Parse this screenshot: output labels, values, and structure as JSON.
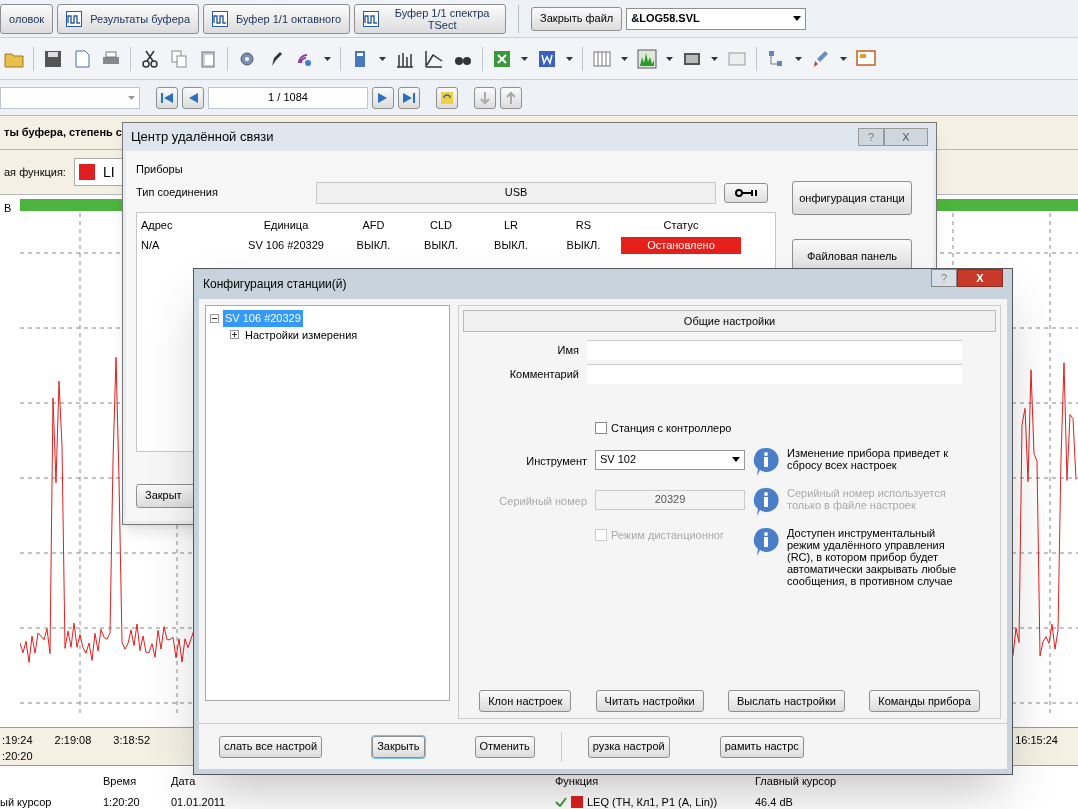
{
  "tabs": [
    {
      "label": "оловок",
      "icon": false
    },
    {
      "label": "Результаты буфера",
      "icon": true
    },
    {
      "label": "Буфер 1/1 октавного",
      "icon": true
    },
    {
      "label": "Буфер 1/1 спектра TSect",
      "icon": true
    }
  ],
  "close_file_button": "Закрыть файл",
  "file_select": "&LOG58.SVL",
  "navigator": {
    "position": "1 / 1084"
  },
  "buffer_title": "ты буфера, степень с",
  "function_row": {
    "label": "ая функция:",
    "value": "LI",
    "color": "#e02020"
  },
  "axis_unit": "B",
  "time_axis": {
    "left": [
      ":19:24",
      "2:19:08",
      "3:18:52"
    ],
    "left_second": ":20:20",
    "right": "16:15:24"
  },
  "bottom_panel": {
    "left_headers": [
      "Время",
      "Дата"
    ],
    "left_row": [
      "ый курсор",
      "1:20:20",
      "01.01.2011"
    ],
    "right_headers": [
      "Функция",
      "Главный курсор"
    ],
    "right_row": {
      "checked": true,
      "color": "#e02020",
      "function": "LEQ (TH, Кл1, P1 (A, Lin))",
      "value": "46.4 dB"
    }
  },
  "remote_dialog": {
    "title": "Центр удалённой связи",
    "devices_label": "Приборы",
    "connection_label": "Тип соединения",
    "connection_value": "USB",
    "columns": [
      "Адрес",
      "Единица",
      "AFD",
      "CLD",
      "LR",
      "RS",
      "Статус"
    ],
    "title_buttons": [
      "?",
      "X"
    ],
    "rows": [
      {
        "cells": [
          "N/A",
          "SV 106 #20329",
          "ВЫКЛ.",
          "ВЫКЛ.",
          "ВЫКЛ.",
          "ВЫКЛ.",
          "Остановлено"
        ]
      }
    ],
    "side_buttons": [
      "онфигурация станци",
      "Файловая панель"
    ],
    "close_button": "Закрыт"
  },
  "config_dialog": {
    "title": "Конфигурация станции(й)",
    "title_buttons": [
      "?",
      "X"
    ],
    "tree": [
      {
        "label": "SV 106 #20329",
        "selected": true,
        "expanded": true,
        "children": [
          {
            "label": "Настройки измерения",
            "selected": false,
            "expanded": false
          }
        ]
      }
    ],
    "section_title": "Общие настройки",
    "name_label": "Имя",
    "comment_label": "Комментарий",
    "controller_checkbox": {
      "label": "Станция с контроллеро",
      "checked": false,
      "disabled": false
    },
    "instrument_label": "Инструмент",
    "instrument_value": "SV 102",
    "serial_label": "Серийный номер",
    "serial_value": "20329",
    "remote_checkbox": {
      "label": "Режим дистанционног",
      "checked": false,
      "disabled": true
    },
    "infos": [
      {
        "text": "Изменение прибора приведет к сбросу всех настроек",
        "disabled": false
      },
      {
        "text": "Серийный номер используется только в файле настроек",
        "disabled": true
      },
      {
        "text": "Доступен инструментальный режим удалённого управления (RC), в котором прибор будет автоматически закрывать любые сообщения, в противном случае",
        "disabled": false
      }
    ],
    "action_buttons": [
      "Клон настроек",
      "Читать настройки",
      "Выслать настройки",
      "Команды прибора"
    ],
    "footer_buttons": [
      {
        "label": "слать все настрой",
        "default": false
      },
      {
        "label": "Закрыть",
        "default": true
      },
      {
        "label": "Отменить",
        "default": false
      },
      {
        "label": "рузка настрой",
        "default": false
      },
      {
        "label": "рамить настрс",
        "default": false
      }
    ]
  }
}
